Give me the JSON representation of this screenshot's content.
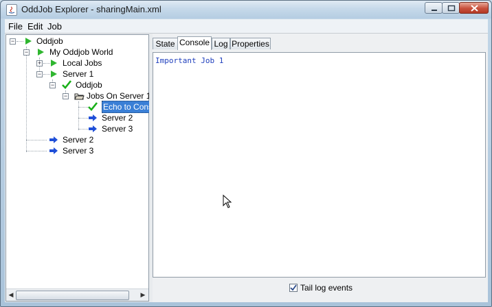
{
  "window": {
    "title": "OddJob Explorer - sharingMain.xml"
  },
  "menu": {
    "items": [
      "File",
      "Edit",
      "Job"
    ]
  },
  "tree": {
    "nodes": [
      {
        "label": "Oddjob",
        "icon": "green-play-icon"
      },
      {
        "label": "My Oddjob World",
        "icon": "green-play-icon"
      },
      {
        "label": "Local Jobs",
        "icon": "green-play-icon"
      },
      {
        "label": "Server 1",
        "icon": "green-play-icon"
      },
      {
        "label": "Oddjob",
        "icon": "green-check-icon"
      },
      {
        "label": "Jobs On Server 1",
        "icon": "folder-icon"
      },
      {
        "label": "Echo to Console",
        "icon": "green-check-icon",
        "selected": true
      },
      {
        "label": "Server 2",
        "icon": "blue-arrow-icon"
      },
      {
        "label": "Server 3",
        "icon": "blue-arrow-icon"
      },
      {
        "label": "Server 2",
        "icon": "blue-arrow-icon"
      },
      {
        "label": "Server 3",
        "icon": "blue-arrow-icon"
      }
    ]
  },
  "tabs": [
    {
      "label": "State"
    },
    {
      "label": "Console",
      "active": true
    },
    {
      "label": "Log"
    },
    {
      "label": "Properties"
    }
  ],
  "console": {
    "lines": [
      "Important Job 1"
    ]
  },
  "tail": {
    "label": "Tail log events",
    "checked": true
  }
}
